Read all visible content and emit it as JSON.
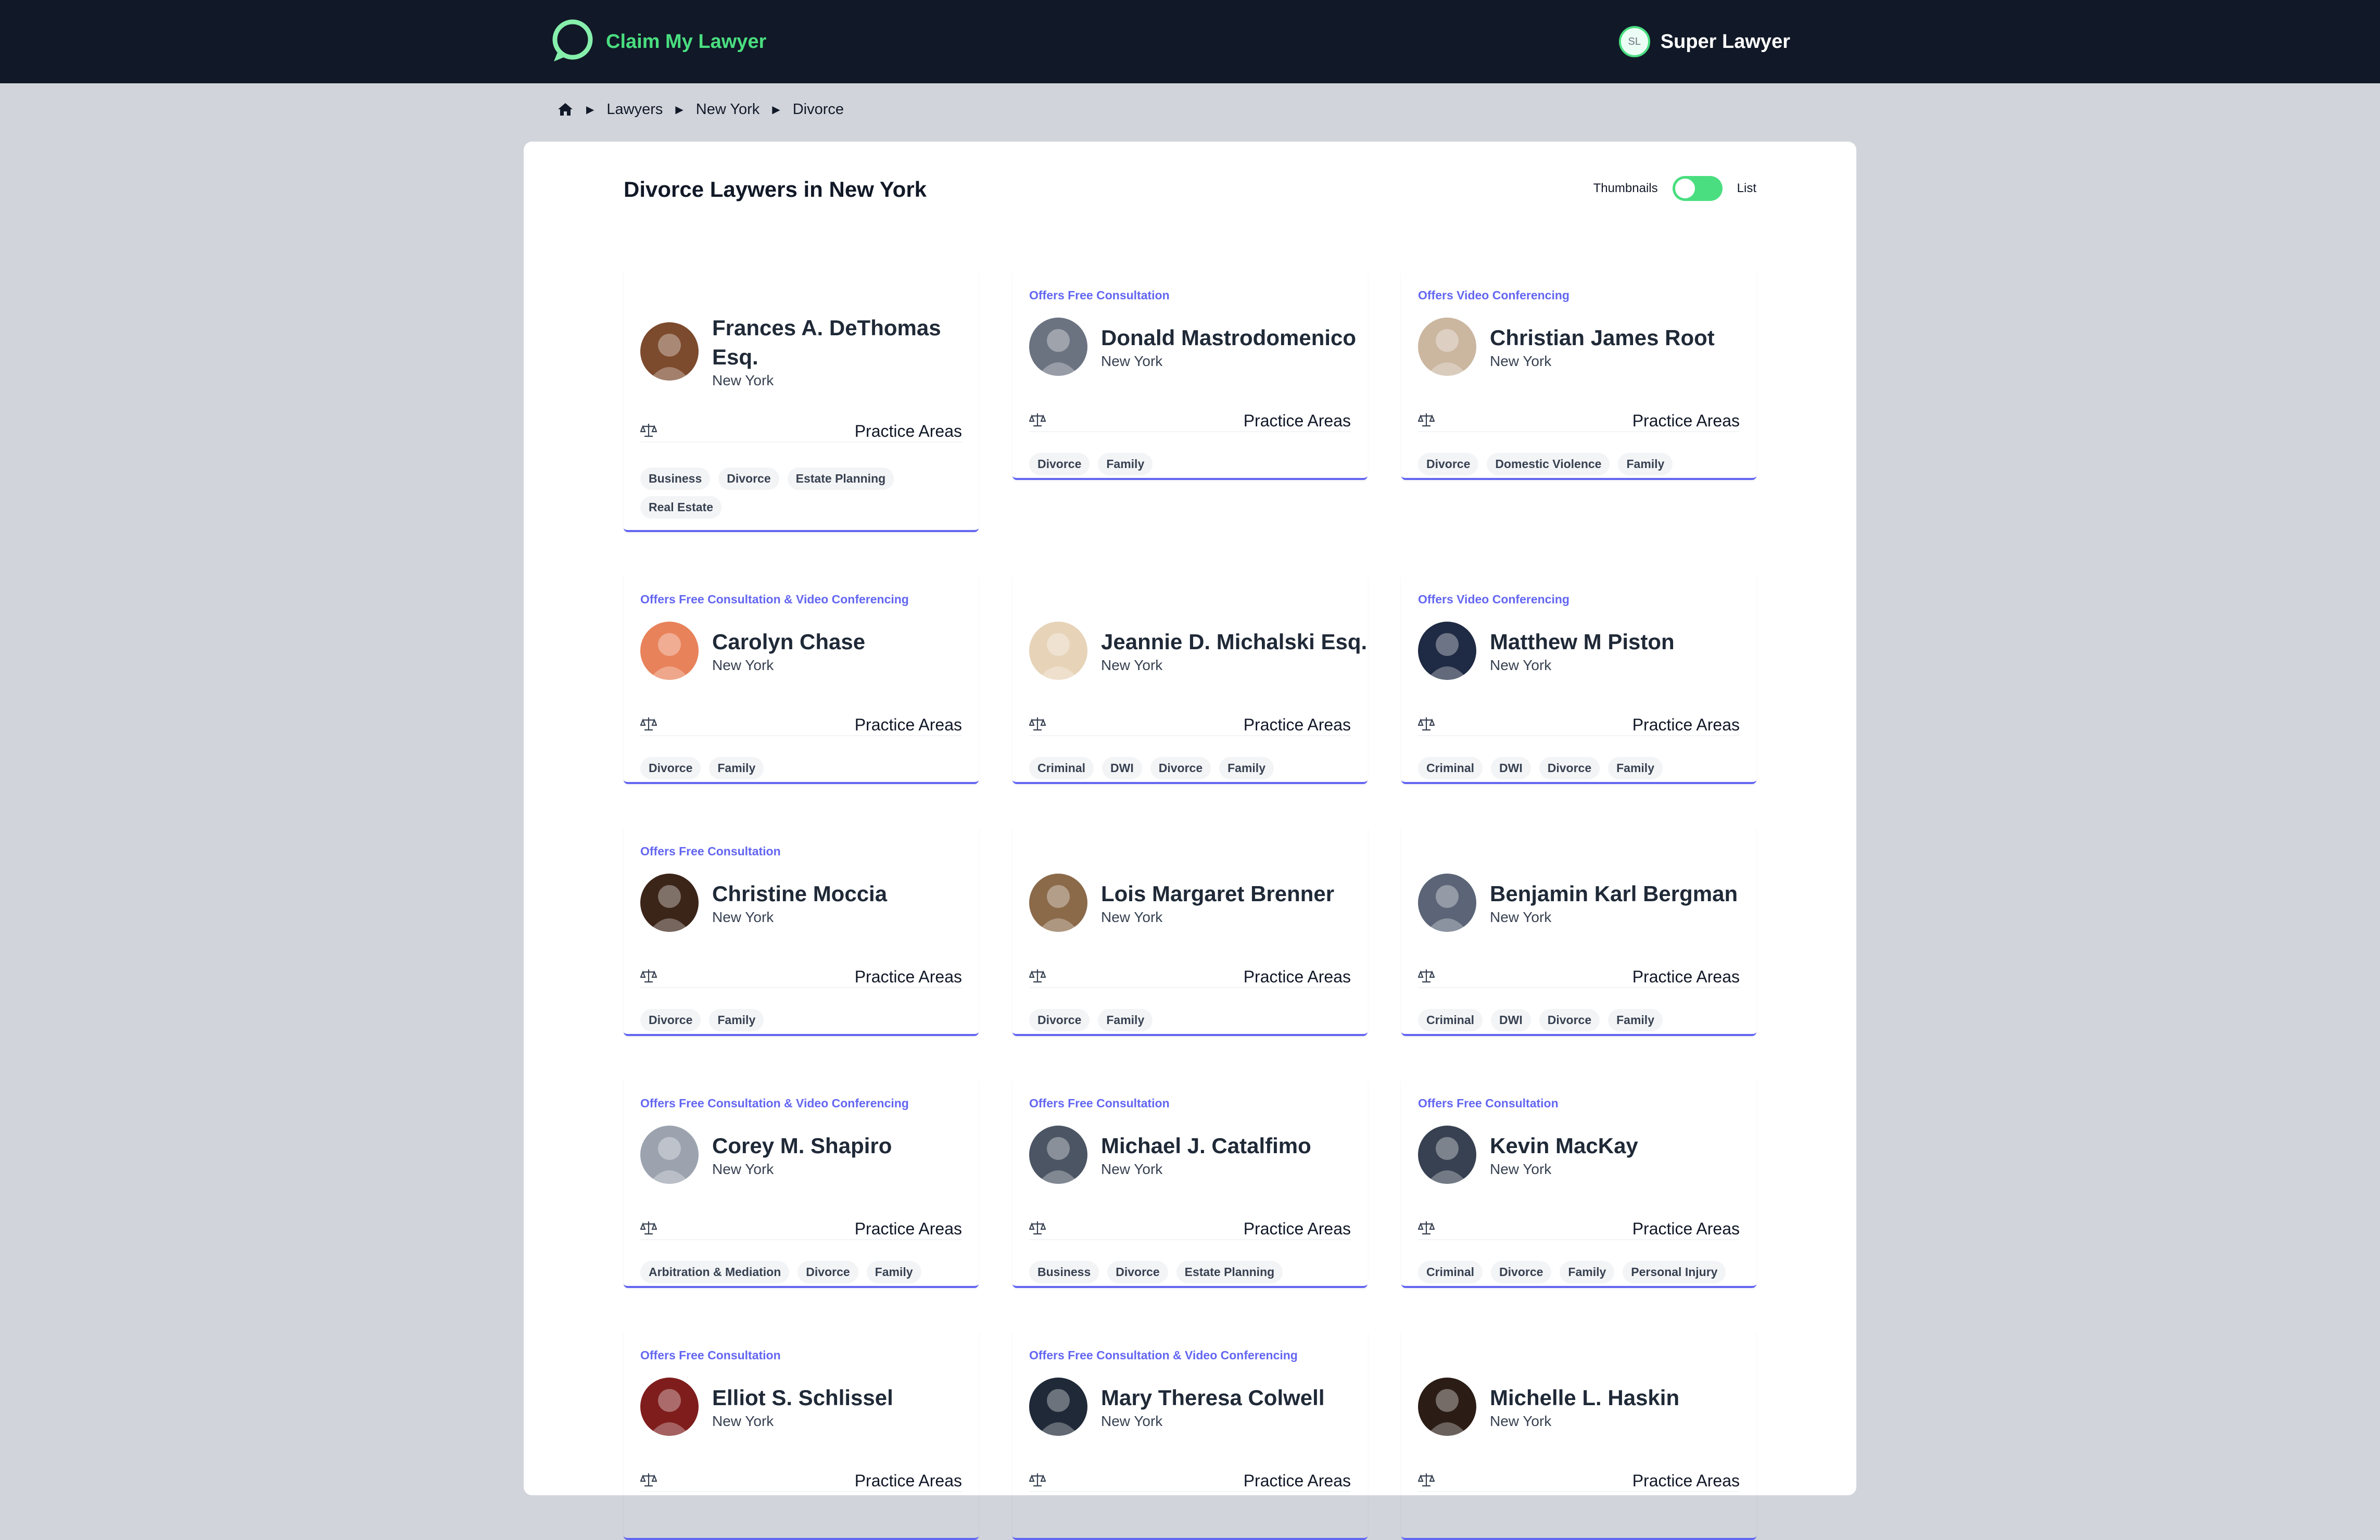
{
  "header": {
    "brand": "Claim My Lawyer",
    "user_initials": "SL",
    "user_name": "Super Lawyer"
  },
  "breadcrumb": [
    "Lawyers",
    "New York",
    "Divorce"
  ],
  "page": {
    "title": "Divorce Laywers in New York",
    "toggle_left": "Thumbnails",
    "toggle_right": "List",
    "practice_label": "Practice Areas"
  },
  "lawyers": [
    {
      "offer": "",
      "name": "Frances A. DeThomas Esq.",
      "city": "New York",
      "tags": [
        "Business",
        "Divorce",
        "Estate Planning",
        "Real Estate"
      ],
      "photo_color": "#7c4a2d"
    },
    {
      "offer": "Offers Free Consultation",
      "name": "Donald Mastrodomenico",
      "city": "New York",
      "tags": [
        "Divorce",
        "Family"
      ],
      "photo_color": "#6b7280"
    },
    {
      "offer": "Offers Video Conferencing",
      "name": "Christian James Root",
      "city": "New York",
      "tags": [
        "Divorce",
        "Domestic Violence",
        "Family"
      ],
      "photo_color": "#cbb6a0"
    },
    {
      "offer": "Offers Free Consultation & Video Conferencing",
      "name": "Carolyn Chase",
      "city": "New York",
      "tags": [
        "Divorce",
        "Family"
      ],
      "photo_color": "#e8825a"
    },
    {
      "offer": "",
      "name": "Jeannie D. Michalski Esq.",
      "city": "New York",
      "tags": [
        "Criminal",
        "DWI",
        "Divorce",
        "Family"
      ],
      "photo_color": "#e7d3b8"
    },
    {
      "offer": "Offers Video Conferencing",
      "name": "Matthew M Piston",
      "city": "New York",
      "tags": [
        "Criminal",
        "DWI",
        "Divorce",
        "Family"
      ],
      "photo_color": "#1f2a44"
    },
    {
      "offer": "Offers Free Consultation",
      "name": "Christine Moccia",
      "city": "New York",
      "tags": [
        "Divorce",
        "Family"
      ],
      "photo_color": "#3b2418"
    },
    {
      "offer": "",
      "name": "Lois Margaret Brenner",
      "city": "New York",
      "tags": [
        "Divorce",
        "Family"
      ],
      "photo_color": "#8b6a4a"
    },
    {
      "offer": "",
      "name": "Benjamin Karl Bergman",
      "city": "New York",
      "tags": [
        "Criminal",
        "DWI",
        "Divorce",
        "Family"
      ],
      "photo_color": "#5b6577"
    },
    {
      "offer": "Offers Free Consultation & Video Conferencing",
      "name": "Corey M. Shapiro",
      "city": "New York",
      "tags": [
        "Arbitration & Mediation",
        "Divorce",
        "Family"
      ],
      "photo_color": "#9ca3af"
    },
    {
      "offer": "Offers Free Consultation",
      "name": "Michael J. Catalfimo",
      "city": "New York",
      "tags": [
        "Business",
        "Divorce",
        "Estate Planning"
      ],
      "photo_color": "#4b5563"
    },
    {
      "offer": "Offers Free Consultation",
      "name": "Kevin MacKay",
      "city": "New York",
      "tags": [
        "Criminal",
        "Divorce",
        "Family",
        "Personal Injury"
      ],
      "photo_color": "#374151"
    },
    {
      "offer": "Offers Free Consultation",
      "name": "Elliot S. Schlissel",
      "city": "New York",
      "tags": [],
      "photo_color": "#7f1d1d"
    },
    {
      "offer": "Offers Free Consultation & Video Conferencing",
      "name": "Mary Theresa Colwell",
      "city": "New York",
      "tags": [],
      "photo_color": "#1f2937"
    },
    {
      "offer": "",
      "name": "Michelle L. Haskin",
      "city": "New York",
      "tags": [],
      "photo_color": "#2b1d16"
    }
  ],
  "colors": {
    "nav_bg": "#111827",
    "accent_green": "#4ade80",
    "accent_indigo": "#6366f1",
    "page_bg": "#d1d5db"
  },
  "icons": {
    "home": "home-icon",
    "practice": "scale-icon",
    "logo": "chat-logo-icon"
  }
}
